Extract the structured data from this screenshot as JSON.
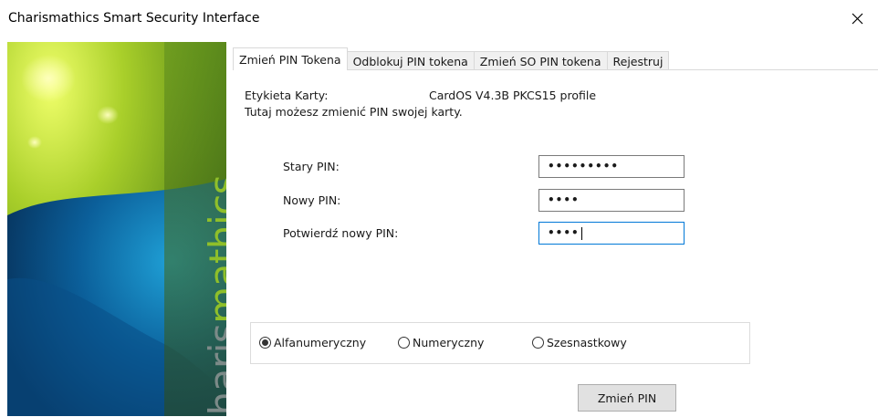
{
  "window": {
    "title": "Charismathics Smart Security Interface"
  },
  "brand": {
    "part1": "charis",
    "part2": "mathics"
  },
  "tabs": [
    {
      "label": "Zmień PIN Tokena",
      "active": true
    },
    {
      "label": "Odblokuj PIN tokena",
      "active": false
    },
    {
      "label": "Zmień SO PIN tokena",
      "active": false
    },
    {
      "label": "Rejestruj",
      "active": false
    }
  ],
  "card": {
    "label": "Etykieta Karty:",
    "value": "CardOS V4.3B PKCS15 profile",
    "description": "Tutaj możesz zmienić PIN swojej karty."
  },
  "fields": {
    "old_pin": {
      "label": "Stary PIN:",
      "value": "•••••••••"
    },
    "new_pin": {
      "label": "Nowy PIN:",
      "value": "••••"
    },
    "confirm_pin": {
      "label": "Potwierdź nowy PIN:",
      "value": "••••"
    }
  },
  "pin_type": {
    "options": [
      "Alfanumeryczny",
      "Numeryczny",
      "Szesnastkowy"
    ],
    "selected": "Alfanumeryczny"
  },
  "actions": {
    "change_pin": "Zmień PIN"
  },
  "colors": {
    "brand_green": "#8fbf2a",
    "brand_gray": "#7c8a88",
    "focus_blue": "#0078d7"
  }
}
